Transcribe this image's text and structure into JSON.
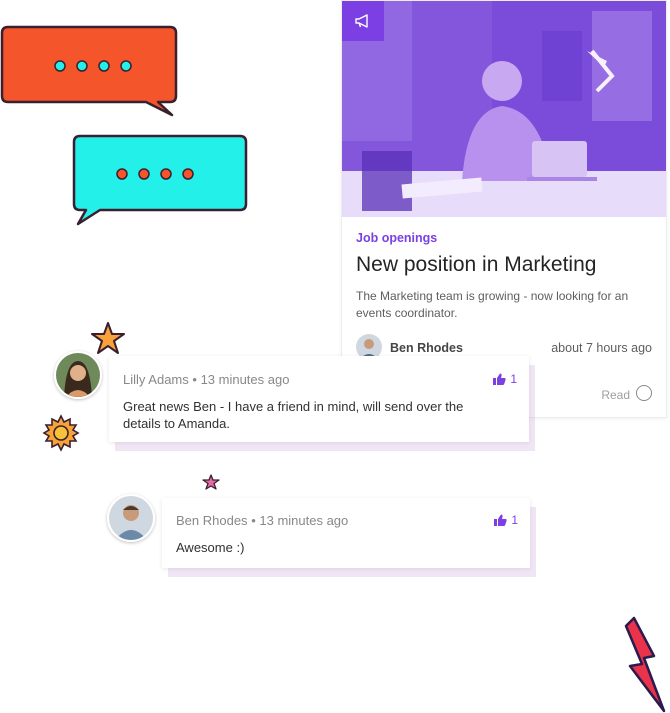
{
  "article": {
    "category": "Job openings",
    "title": "New position in Marketing",
    "description": "The Marketing team is growing - now looking for an events coordinator.",
    "author": "Ben Rhodes",
    "time": "about 7 hours ago",
    "read_label": "Read",
    "tag_icon": "megaphone-icon"
  },
  "comments": [
    {
      "author": "Lilly Adams",
      "separator": "•",
      "time": "13 minutes ago",
      "likes": "1",
      "text": "Great news Ben - I have a friend in mind, will send over the details to Amanda."
    },
    {
      "author": "Ben Rhodes",
      "separator": "•",
      "time": "13 minutes ago",
      "likes": "1",
      "text": "Awesome :)"
    }
  ],
  "colors": {
    "accent": "#7b3fe4",
    "bubble_orange": "#f4552a",
    "bubble_cyan": "#24f0ea"
  }
}
